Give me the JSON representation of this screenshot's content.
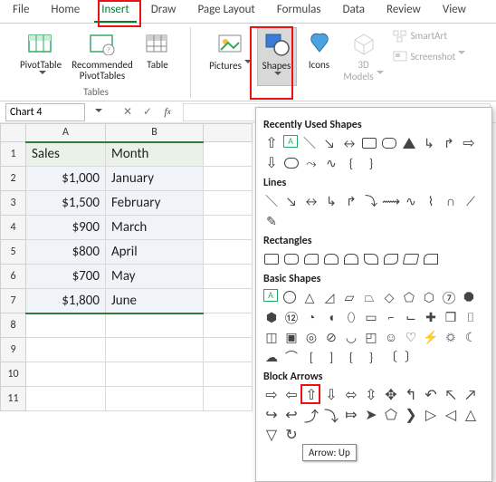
{
  "tabs": [
    "File",
    "Home",
    "Insert",
    "Draw",
    "Page Layout",
    "Formulas",
    "Data",
    "Review",
    "View"
  ],
  "active_tab": 2,
  "ribbon": {
    "pivot": "PivotTable",
    "recpivot": "Recommended\nPivotTables",
    "table": "Table",
    "tables_group": "Tables",
    "pictures": "Pictures",
    "shapes": "Shapes",
    "icons": "Icons",
    "threed": "3D\nModels",
    "smartart": "SmartArt",
    "screenshot": "Screenshot"
  },
  "namebox": "Chart 4",
  "grid": {
    "cols": [
      "A",
      "B"
    ],
    "rows": [
      {
        "A": "Sales",
        "B": "Month"
      },
      {
        "A": "$1,000",
        "B": "January"
      },
      {
        "A": "$1,500",
        "B": "February"
      },
      {
        "A": "$900",
        "B": "March"
      },
      {
        "A": "$800",
        "B": "April"
      },
      {
        "A": "$700",
        "B": "May"
      },
      {
        "A": "$1,800",
        "B": "June"
      }
    ]
  },
  "panel": {
    "sect_recent": "Recently Used Shapes",
    "sect_lines": "Lines",
    "sect_rect": "Rectangles",
    "sect_basic": "Basic Shapes",
    "sect_block": "Block Arrows"
  },
  "tooltip": "Arrow: Up",
  "colors": {
    "accent": "#0b7a3b",
    "highlight": "#e11"
  }
}
